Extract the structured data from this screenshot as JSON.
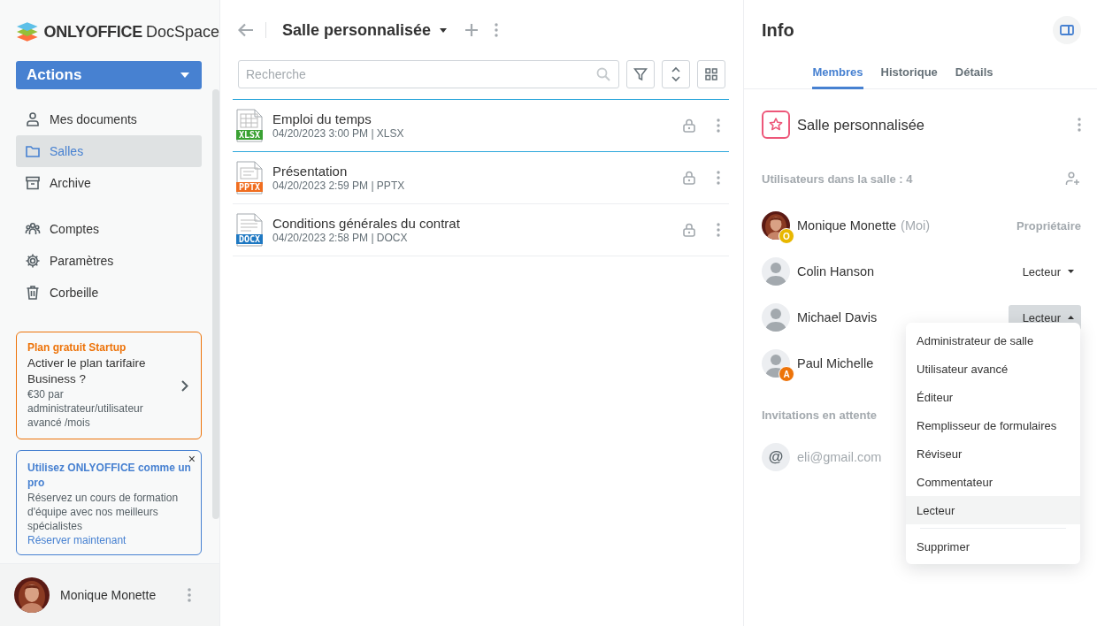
{
  "logo": {
    "brand": "ONLYOFFICE",
    "product": "DocSpace"
  },
  "actions_button": "Actions",
  "nav_main": [
    {
      "label": "Mes documents",
      "kind": "user",
      "selected": false
    },
    {
      "label": "Salles",
      "kind": "folder",
      "selected": true
    },
    {
      "label": "Archive",
      "kind": "archive",
      "selected": false
    }
  ],
  "nav_secondary": [
    {
      "label": "Comptes",
      "kind": "people",
      "selected": false
    },
    {
      "label": "Paramètres",
      "kind": "gear",
      "selected": false
    },
    {
      "label": "Corbeille",
      "kind": "trash",
      "selected": false
    }
  ],
  "plan_card": {
    "title": "Plan gratuit Startup",
    "heading": "Activer le plan tarifaire Business ?",
    "text": "€30 par administrateur/utilisateur avancé /mois"
  },
  "promo_card": {
    "title": "Utilisez ONLYOFFICE comme un pro",
    "text": "Réservez un cours de formation d'équipe avec nos meilleurs spécialistes",
    "link": "Réserver maintenant",
    "close": "×"
  },
  "current_user": {
    "name": "Monique Monette"
  },
  "header": {
    "title": "Salle personnalisée"
  },
  "search": {
    "placeholder": "Recherche"
  },
  "files": [
    {
      "name": "Emploi du temps",
      "meta": "04/20/2023 3:00 PM | XLSX",
      "kind": "sheet",
      "icon_label": "XLSX",
      "selected": true
    },
    {
      "name": "Présentation",
      "meta": "04/20/2023 2:59 PM | PPTX",
      "kind": "slides",
      "icon_label": "PPTX",
      "selected": false
    },
    {
      "name": "Conditions générales du contrat",
      "meta": "04/20/2023 2:58 PM | DOCX",
      "kind": "doc",
      "icon_label": "DOCX",
      "selected": false
    }
  ],
  "info": {
    "title": "Info",
    "tabs": [
      {
        "label": "Membres",
        "selected": true
      },
      {
        "label": "Historique",
        "selected": false
      },
      {
        "label": "Détails",
        "selected": false
      }
    ],
    "room_name": "Salle personnalisée",
    "users_label": "Utilisateurs dans la salle : 4",
    "members": [
      {
        "name": "Monique Monette",
        "suffix": "(Moi)",
        "badge": {
          "letter": "O",
          "color": "#e8b700"
        },
        "role": {
          "kind": "text",
          "label": "Propriétaire"
        }
      },
      {
        "name": "Colin Hanson",
        "avatar": {
          "kind": "default"
        },
        "role": {
          "kind": "dropdown",
          "label": "Lecteur",
          "expanded": false
        }
      },
      {
        "name": "Michael Davis",
        "avatar": {
          "kind": "default"
        },
        "role": {
          "kind": "dropdown",
          "label": "Lecteur",
          "expanded": true
        }
      },
      {
        "name": "Paul Michelle",
        "avatar": {
          "kind": "default"
        },
        "badge": {
          "letter": "A",
          "color": "#ed7309"
        }
      }
    ],
    "pending_label": "Invitations en attente",
    "invites": [
      {
        "symbol": "@",
        "email": "eli@gmail.com"
      }
    ]
  },
  "role_menu": {
    "items": [
      {
        "label": "Administrateur de salle",
        "selected": false
      },
      {
        "label": "Utilisateur avancé",
        "selected": false
      },
      {
        "label": "Éditeur",
        "selected": false
      },
      {
        "label": "Remplisseur de formulaires",
        "selected": false
      },
      {
        "label": "Réviseur",
        "selected": false
      },
      {
        "label": "Commentateur",
        "selected": false
      },
      {
        "label": "Lecteur",
        "selected": true
      }
    ],
    "delete": "Supprimer"
  }
}
